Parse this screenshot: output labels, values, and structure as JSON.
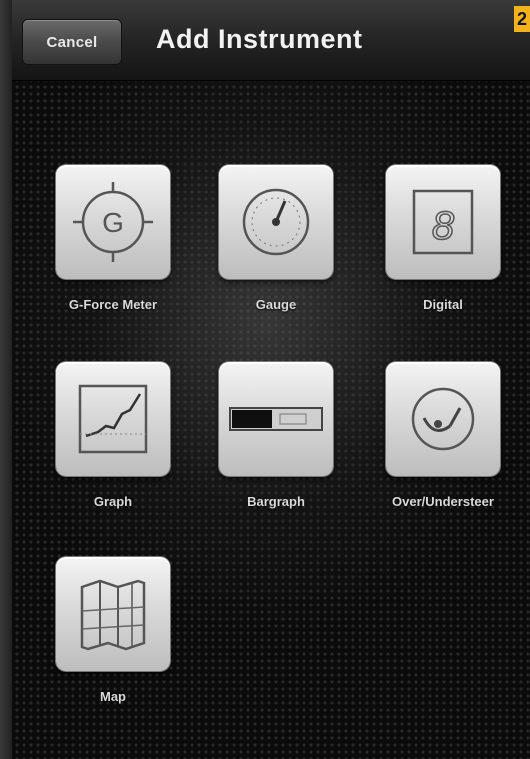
{
  "header": {
    "cancel_label": "Cancel",
    "title": "Add Instrument",
    "badge": "2"
  },
  "instruments": [
    {
      "label": "G-Force Meter",
      "icon": "g-force-icon",
      "icon_text": "G"
    },
    {
      "label": "Gauge",
      "icon": "gauge-icon"
    },
    {
      "label": "Digital",
      "icon": "digital-icon",
      "icon_text": "8"
    },
    {
      "label": "Graph",
      "icon": "graph-icon"
    },
    {
      "label": "Bargraph",
      "icon": "bargraph-icon"
    },
    {
      "label": "Over/Understeer",
      "icon": "steering-icon"
    },
    {
      "label": "Map",
      "icon": "map-icon"
    }
  ],
  "colors": {
    "badge": "#f2b21b",
    "tile_face": "#dcdcdc",
    "icon_stroke": "#555555"
  }
}
